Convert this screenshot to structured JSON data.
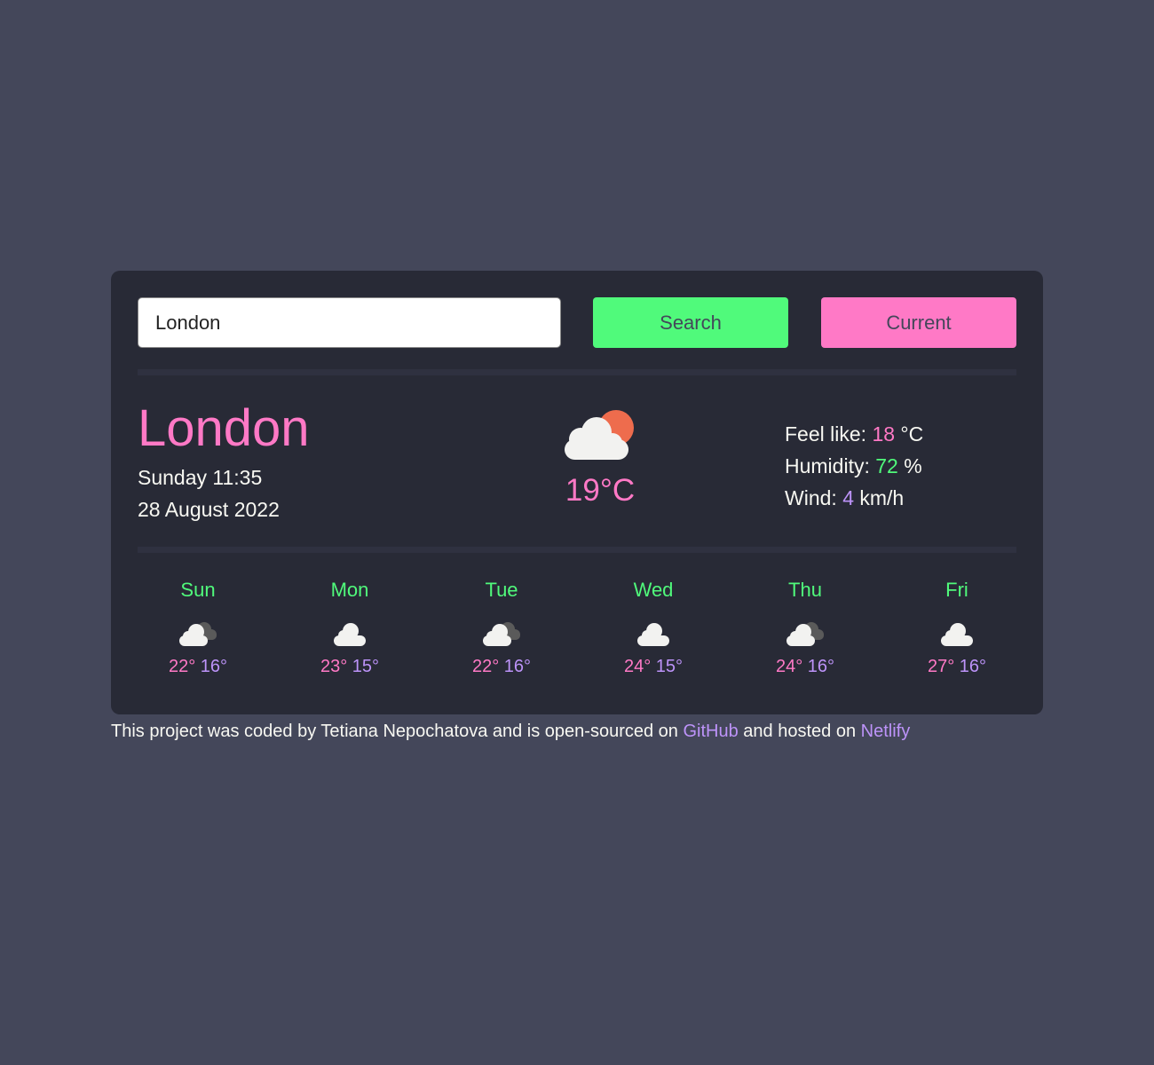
{
  "search": {
    "value": "London",
    "search_label": "Search",
    "current_label": "Current"
  },
  "current": {
    "city": "London",
    "day_time": "Sunday 11:35",
    "date": "28 August 2022",
    "icon": "partly-cloudy-day-icon",
    "temperature": "19°C",
    "feels_like_label": "Feel like:",
    "feels_like_value": "18",
    "feels_like_unit": "°C",
    "humidity_label": "Humidity:",
    "humidity_value": "72",
    "humidity_unit": "%",
    "wind_label": "Wind:",
    "wind_value": "4",
    "wind_unit": "km/h"
  },
  "forecast": [
    {
      "day": "Sun",
      "icon": "cloud-with-dark-cloud-icon",
      "max": "22°",
      "min": "16°"
    },
    {
      "day": "Mon",
      "icon": "cloud-icon",
      "max": "23°",
      "min": "15°"
    },
    {
      "day": "Tue",
      "icon": "cloud-with-dark-cloud-icon",
      "max": "22°",
      "min": "16°"
    },
    {
      "day": "Wed",
      "icon": "cloud-icon",
      "max": "24°",
      "min": "15°"
    },
    {
      "day": "Thu",
      "icon": "cloud-with-dark-cloud-icon",
      "max": "24°",
      "min": "16°"
    },
    {
      "day": "Fri",
      "icon": "cloud-icon",
      "max": "27°",
      "min": "16°"
    }
  ],
  "footer": {
    "text_before": "This project was coded by Tetiana Nepochatova and is open-sourced on ",
    "github_label": "GitHub",
    "text_middle": " and hosted on ",
    "netlify_label": "Netlify"
  },
  "colors": {
    "background": "#44475a",
    "card": "#282a36",
    "pink": "#ff79c6",
    "green": "#50fa7b",
    "purple": "#bd93f9",
    "text": "#f8f8f2"
  }
}
